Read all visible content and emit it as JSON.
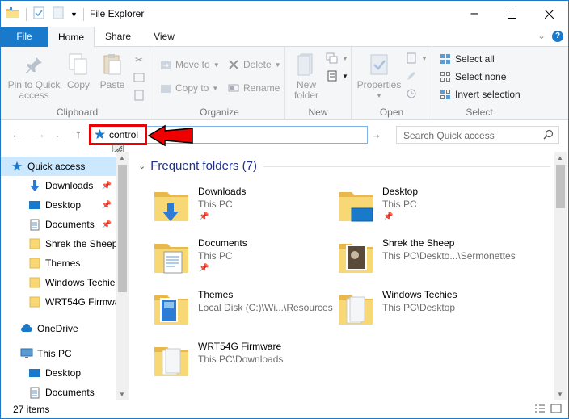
{
  "title": "File Explorer",
  "ribbon_tabs": [
    "File",
    "Home",
    "Share",
    "View"
  ],
  "clipboard": {
    "pin_label": "Pin to Quick access",
    "copy_label": "Copy",
    "paste_label": "Paste",
    "group_label": "Clipboard"
  },
  "organize": {
    "move_to": "Move to",
    "copy_to": "Copy to",
    "delete": "Delete",
    "rename": "Rename",
    "group_label": "Organize"
  },
  "new": {
    "new_folder": "New folder",
    "group_label": "New"
  },
  "open": {
    "properties": "Properties",
    "group_label": "Open"
  },
  "select": {
    "select_all": "Select all",
    "select_none": "Select none",
    "invert_selection": "Invert selection",
    "group_label": "Select"
  },
  "address": {
    "value": "control"
  },
  "search": {
    "placeholder": "Search Quick access"
  },
  "nav": {
    "quick_access": "Quick access",
    "items": [
      "Downloads",
      "Desktop",
      "Documents",
      "Shrek the Sheep",
      "Themes",
      "Windows Techie",
      "WRT54G Firmwa"
    ],
    "onedrive": "OneDrive",
    "this_pc": "This PC",
    "pc_items": [
      "Desktop",
      "Documents"
    ]
  },
  "content": {
    "section_title": "Frequent folders (7)",
    "folders": [
      {
        "name": "Downloads",
        "location": "This PC",
        "pinned": true
      },
      {
        "name": "Desktop",
        "location": "This PC",
        "pinned": true
      },
      {
        "name": "Documents",
        "location": "This PC",
        "pinned": true
      },
      {
        "name": "Shrek the Sheep",
        "location": "This PC\\Deskto...\\Sermonettes",
        "pinned": false
      },
      {
        "name": "Themes",
        "location": "Local Disk (C:)\\Wi...\\Resources",
        "pinned": false
      },
      {
        "name": "Windows Techies",
        "location": "This PC\\Desktop",
        "pinned": false
      },
      {
        "name": "WRT54G Firmware",
        "location": "This PC\\Downloads",
        "pinned": false
      }
    ]
  },
  "status": {
    "item_count": "27 items"
  },
  "colors": {
    "accent": "#1979ca",
    "highlight_box": "#ee0000",
    "section_title": "#1e3287"
  }
}
